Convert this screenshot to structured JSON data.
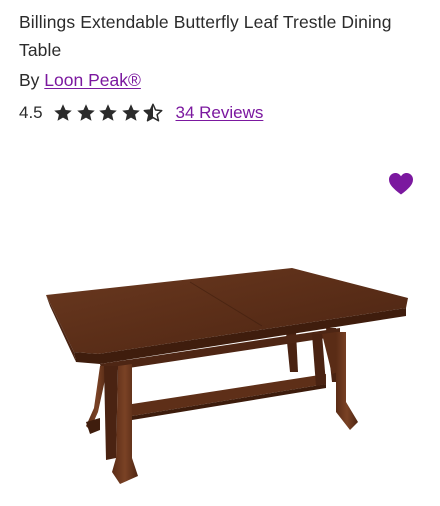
{
  "product": {
    "title": "Billings Extendable Butterfly Leaf Trestle Dining Table",
    "brand_prefix": "By ",
    "brand_name": "Loon Peak®",
    "rating": {
      "value_text": "4.5",
      "value": 4.5,
      "max": 5,
      "reviews_label": "34 Reviews"
    },
    "image_alt": "wooden trestle dining table",
    "wishlist_icon": "heart-icon"
  },
  "colors": {
    "accent": "#7b189f",
    "text": "#2b2b2b",
    "star": "#2b2b2b",
    "wood": "#5a2d18"
  }
}
